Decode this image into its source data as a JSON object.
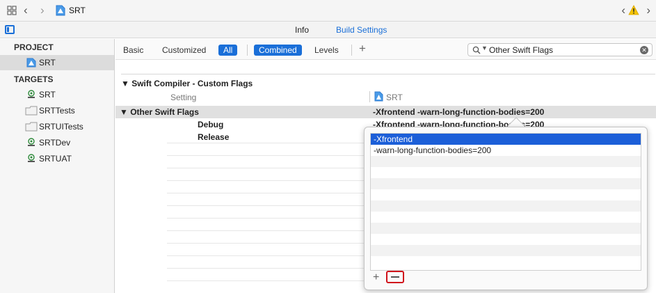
{
  "jump_bar": {
    "title": "SRT"
  },
  "tabs": {
    "info": "Info",
    "build_settings": "Build Settings"
  },
  "sidebar": {
    "project_header": "PROJECT",
    "project_items": [
      {
        "label": "SRT",
        "icon": "project-icon"
      }
    ],
    "targets_header": "TARGETS",
    "target_items": [
      {
        "label": "SRT",
        "icon": "app-target-icon"
      },
      {
        "label": "SRTTests",
        "icon": "test-bundle-icon"
      },
      {
        "label": "SRTUITests",
        "icon": "test-bundle-icon"
      },
      {
        "label": "SRTDev",
        "icon": "app-target-icon"
      },
      {
        "label": "SRTUAT",
        "icon": "app-target-icon"
      }
    ]
  },
  "filter_bar": {
    "basic": "Basic",
    "customized": "Customized",
    "all": "All",
    "combined": "Combined",
    "levels": "Levels",
    "add": "+",
    "search_value": "Other Swift Flags"
  },
  "settings": {
    "section_title": "Swift Compiler - Custom Flags",
    "column_setting": "Setting",
    "column_target": "SRT",
    "row_label": "Other Swift Flags",
    "row_value": "-Xfrontend -warn-long-function-bodies=200",
    "sub_rows": [
      {
        "label": "Debug",
        "value": "-Xfrontend -warn-long-function-bodies=200"
      },
      {
        "label": "Release",
        "value": ""
      }
    ]
  },
  "popover": {
    "items": [
      "-Xfrontend",
      "-warn-long-function-bodies=200"
    ],
    "add_label": "+"
  },
  "colors": {
    "accent": "#1a6fd8",
    "selection": "#1c5fd8",
    "highlight_red": "#d0121b"
  }
}
